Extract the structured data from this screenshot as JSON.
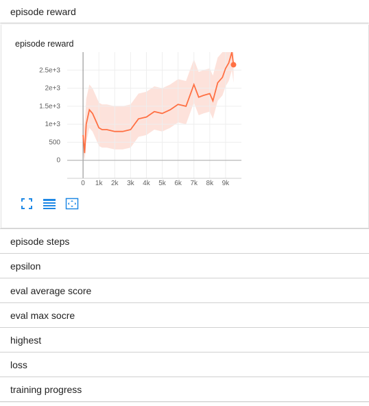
{
  "header": {
    "title": "episode reward"
  },
  "card": {
    "title": "episode reward"
  },
  "rows": [
    {
      "label": "episode steps"
    },
    {
      "label": "epsilon"
    },
    {
      "label": "eval average score"
    },
    {
      "label": "eval max socre"
    },
    {
      "label": "highest"
    },
    {
      "label": "loss"
    },
    {
      "label": "training progress"
    }
  ],
  "toolbar": [
    {
      "icon": "fullscreen-icon"
    },
    {
      "icon": "data-table-icon"
    },
    {
      "icon": "fit-domain-icon"
    }
  ],
  "colors": {
    "line": "#ff7043",
    "band": "#fcd6cc",
    "accent": "#1e88e5"
  },
  "chart_data": {
    "type": "line",
    "title": "episode reward",
    "xlim": [
      -1000,
      10000
    ],
    "ylim": [
      -500,
      3000
    ],
    "xticks": [
      0,
      1000,
      2000,
      3000,
      4000,
      5000,
      6000,
      7000,
      8000,
      9000
    ],
    "xtick_labels": [
      "0",
      "1k",
      "2k",
      "3k",
      "4k",
      "5k",
      "6k",
      "7k",
      "8k",
      "9k"
    ],
    "yticks": [
      0,
      500,
      1000,
      1500,
      2000,
      2500
    ],
    "ytick_labels": [
      "0",
      "500",
      "1e+3",
      "1.5e+3",
      "2e+3",
      "2.5e+3"
    ],
    "series": [
      {
        "x": [
          0,
          100,
          200,
          300,
          400,
          600,
          800,
          1000,
          1200,
          1500,
          2000,
          2500,
          3000,
          3500,
          4000,
          4500,
          5000,
          5500,
          6000,
          6500,
          7000,
          7300,
          7600,
          8000,
          8200,
          8500,
          8800,
          9000,
          9200,
          9400,
          9500
        ],
        "y": [
          700,
          200,
          1000,
          1200,
          1400,
          1300,
          1100,
          900,
          850,
          850,
          800,
          800,
          850,
          1150,
          1200,
          1350,
          1300,
          1400,
          1550,
          1500,
          2100,
          1750,
          1800,
          1850,
          1650,
          2150,
          2300,
          2550,
          2700,
          3000,
          2650
        ]
      }
    ]
  }
}
